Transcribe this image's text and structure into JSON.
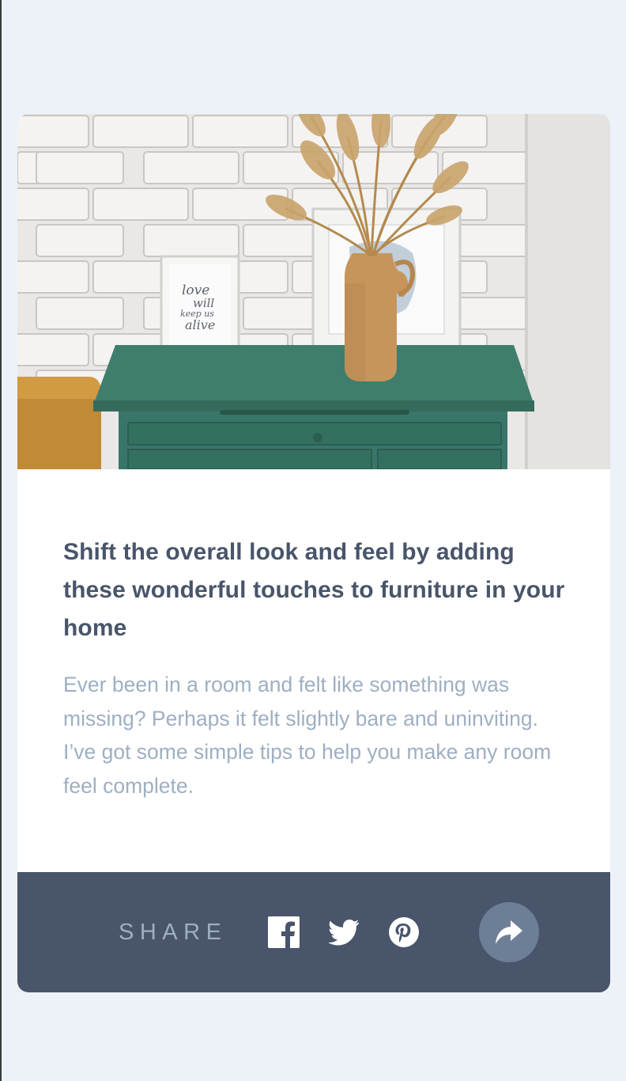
{
  "article": {
    "image_alt": "drawers",
    "title": "Shift the overall look and feel by adding these wonderful touches to furniture in your home",
    "description": "Ever been in a room and felt like something was missing? Perhaps it felt slightly bare and uninviting. I’ve got some simple tips to help you make any room feel complete."
  },
  "frame_text": {
    "line1": "love",
    "line2": "will",
    "line3": "keep us",
    "line4": "alive"
  },
  "share": {
    "label": "SHARE",
    "icons": [
      "facebook-icon",
      "twitter-icon",
      "pinterest-icon"
    ],
    "button_icon": "share-arrow-icon"
  },
  "colors": {
    "background": "#ecf2f8",
    "card": "#ffffff",
    "share_bar": "#48556a",
    "share_button": "#6d7f97",
    "heading": "#48556a",
    "body_text": "#9eafc2",
    "cabinet_green": "#3d7a6a",
    "vase": "#c9985f"
  }
}
